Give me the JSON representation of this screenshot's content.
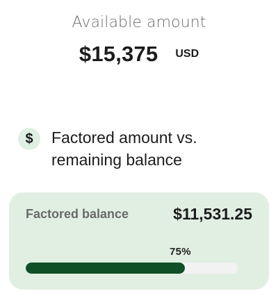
{
  "available": {
    "label": "Available amount",
    "value": "$15,375",
    "currency": "USD"
  },
  "section": {
    "icon": "dollar-icon",
    "title": "Factored amount vs. remaining balance"
  },
  "card": {
    "label": "Factored balance",
    "value": "$11,531.25",
    "percent_label": "75%",
    "progress_fraction": 0.75
  },
  "colors": {
    "accent_dark": "#0f5026",
    "card_background": "#e1efe3",
    "badge_background": "#e0efe3",
    "track": "#f2f2f2"
  }
}
